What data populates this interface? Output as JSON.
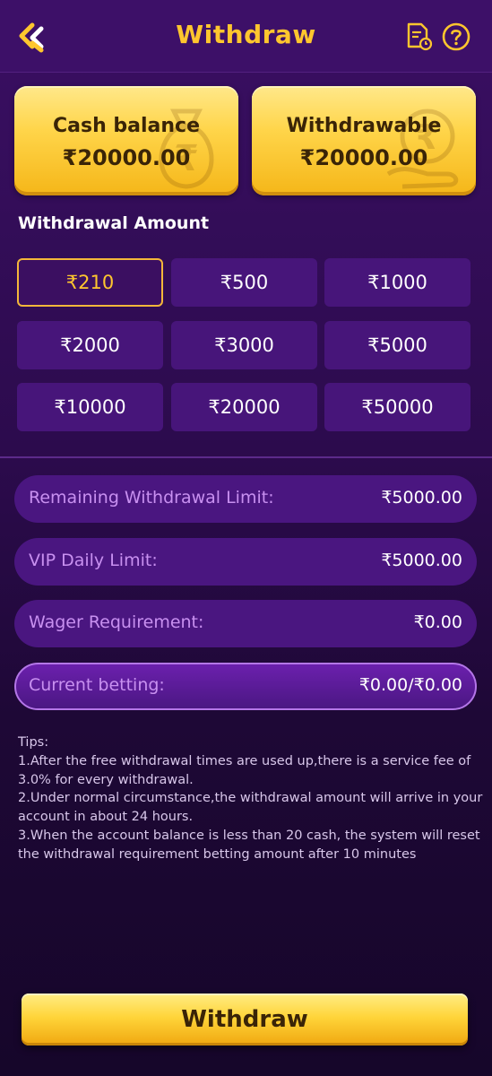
{
  "header": {
    "title": "Withdraw",
    "back_icon": "back-chevron-icon",
    "record_icon": "document-clock-icon",
    "help_icon": "help-circle-icon",
    "accent_color": "#ffc62e"
  },
  "balances": {
    "cash_label": "Cash balance",
    "cash_value": "₹20000.00",
    "withdrawable_label": "Withdrawable",
    "withdrawable_value": "₹20000.00"
  },
  "amount_section": {
    "label": "Withdrawal Amount",
    "selected": "₹210",
    "options": [
      "₹210",
      "₹500",
      "₹1000",
      "₹2000",
      "₹3000",
      "₹5000",
      "₹10000",
      "₹20000",
      "₹50000"
    ]
  },
  "limits": [
    {
      "label": "Remaining Withdrawal Limit:",
      "value": "₹5000.00"
    },
    {
      "label": "VIP Daily Limit:",
      "value": "₹5000.00"
    },
    {
      "label": "Wager Requirement:",
      "value": "₹0.00"
    },
    {
      "label": "Current betting:",
      "value": "₹0.00/₹0.00"
    }
  ],
  "tips": {
    "heading": "Tips:",
    "lines": [
      "1.After the free withdrawal times are used up,there is a service fee of 3.0% for every withdrawal.",
      "2.Under normal circumstance,the withdrawal amount will arrive in your account  in  about 24 hours.",
      "3.When the account balance is less than 20 cash, the system will reset the withdrawal requirement betting amount after 10 minutes"
    ]
  },
  "action": {
    "withdraw_label": "Withdraw"
  }
}
